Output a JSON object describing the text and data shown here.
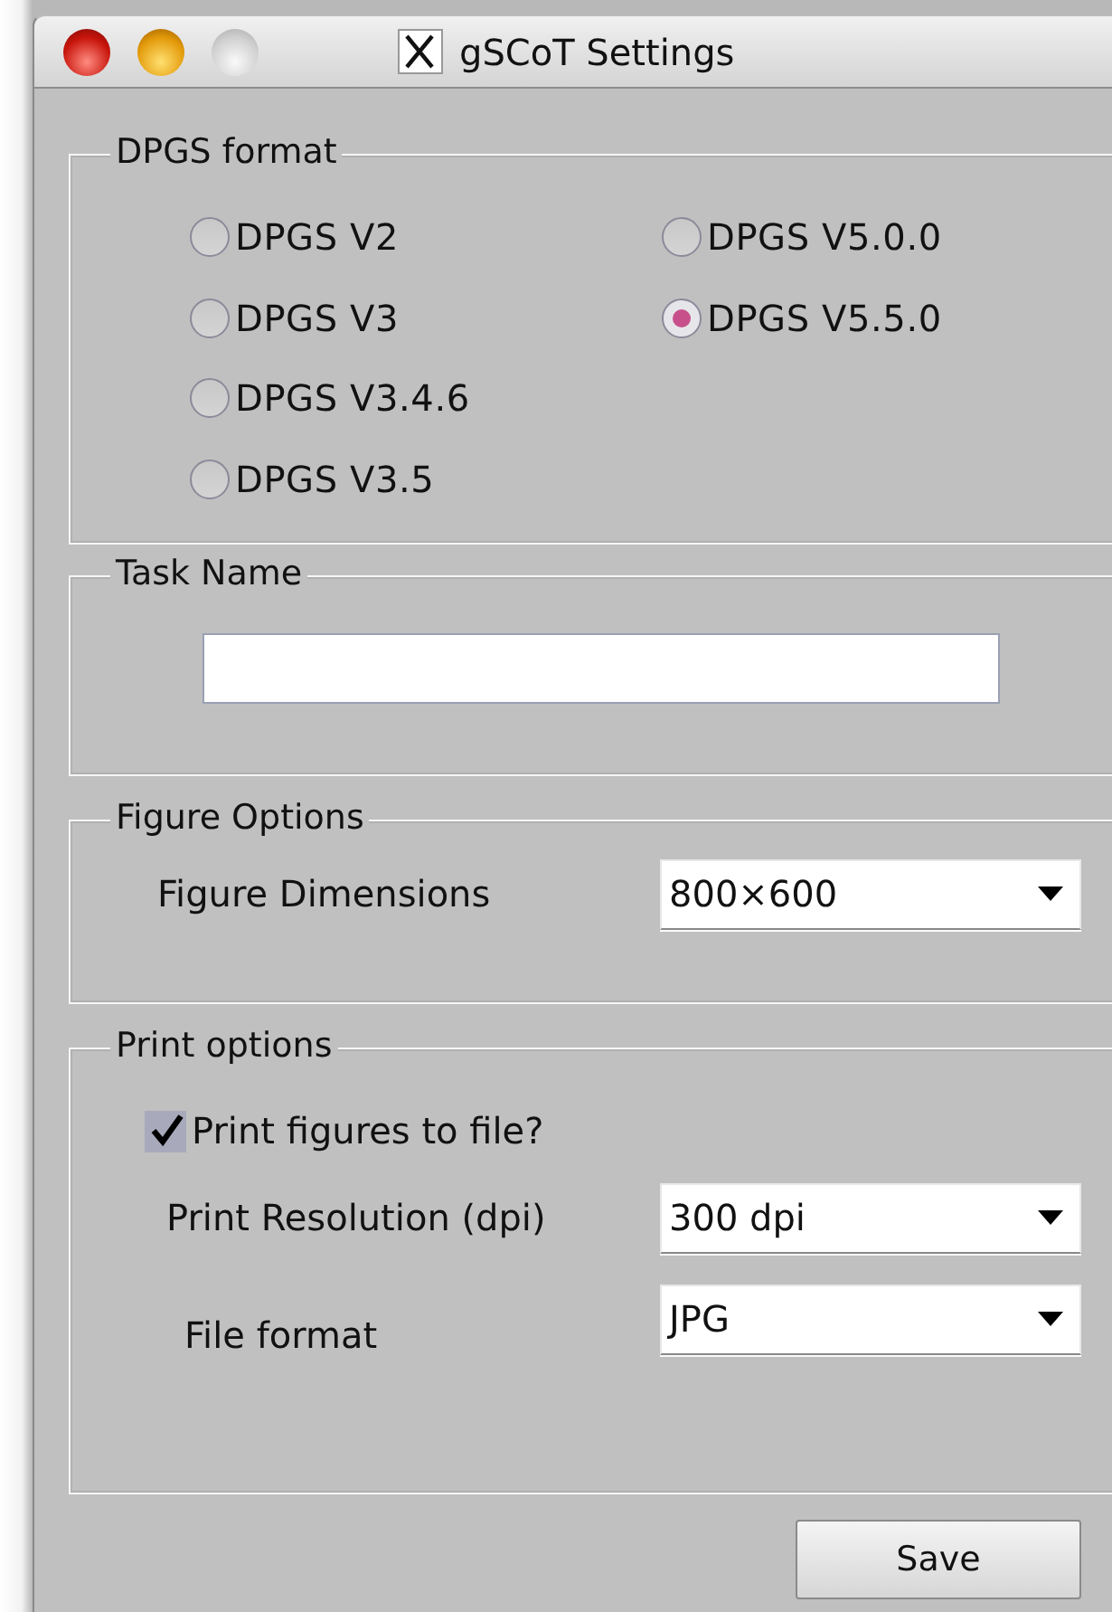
{
  "window": {
    "title": "gSCoT Settings"
  },
  "dpgs_format": {
    "label": "DPGS format",
    "options": [
      {
        "label": "DPGS V2",
        "selected": false
      },
      {
        "label": "DPGS V3",
        "selected": false
      },
      {
        "label": "DPGS V3.4.6",
        "selected": false
      },
      {
        "label": "DPGS V3.5",
        "selected": false
      },
      {
        "label": "DPGS V5.0.0",
        "selected": false
      },
      {
        "label": "DPGS V5.5.0",
        "selected": true
      }
    ]
  },
  "task_name": {
    "label": "Task Name"
  },
  "figure_options": {
    "label": "Figure Options",
    "fields": [
      {
        "label": "Figure Dimensions",
        "value": "800×600"
      }
    ]
  },
  "print_options": {
    "label": "Print options",
    "checkbox": {
      "label": "Print figures to file?",
      "checked": true
    },
    "fields": [
      {
        "label": "Print Resolution (dpi)",
        "value": "300 dpi"
      },
      {
        "label": "File format",
        "value": "JPG"
      }
    ]
  },
  "buttons": [
    "Save"
  ]
}
